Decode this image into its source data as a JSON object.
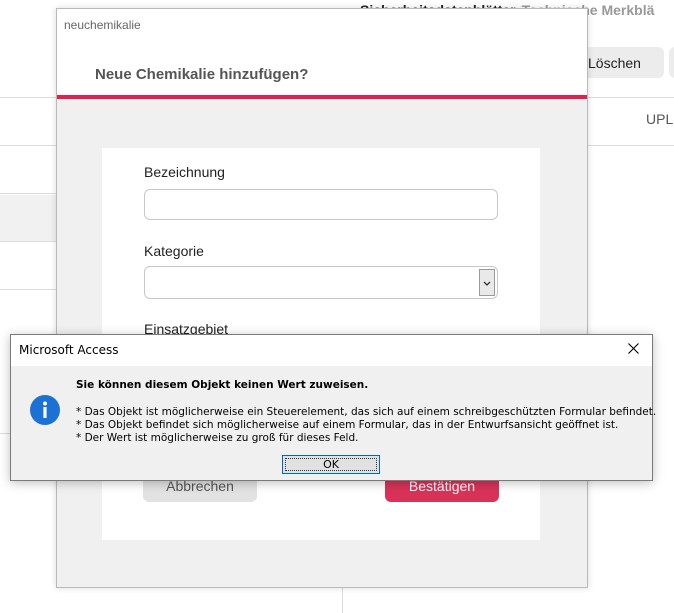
{
  "background": {
    "tab_1": "Sicherheitsdatenblätter",
    "tab_2": "Technische Merkblä",
    "delete_button": "Löschen",
    "upload_label": "UPL"
  },
  "form_window": {
    "window_title": "neuchemikalie",
    "heading": "Neue Chemikalie hinzufügen?",
    "accent_color": "#e2204f",
    "fields": {
      "bezeichnung_label": "Bezeichnung",
      "bezeichnung_value": "",
      "kategorie_label": "Kategorie",
      "kategorie_value": "",
      "einsatzgebiet_label": "Einsatzgebiet"
    },
    "cancel_button": "Abbrechen",
    "confirm_button": "Bestätigen"
  },
  "message_box": {
    "title": "Microsoft Access",
    "heading": "Sie können diesem Objekt keinen Wert zuweisen.",
    "lines": [
      "* Das Objekt ist möglicherweise ein Steuerelement, das sich auf einem schreibgeschützten Formular befindet.",
      "* Das Objekt befindet sich möglicherweise auf einem Formular, das in der Entwurfsansicht geöffnet ist.",
      "* Der Wert ist möglicherweise zu groß für dieses Feld."
    ],
    "ok_button": "OK",
    "icon": "info-icon"
  }
}
